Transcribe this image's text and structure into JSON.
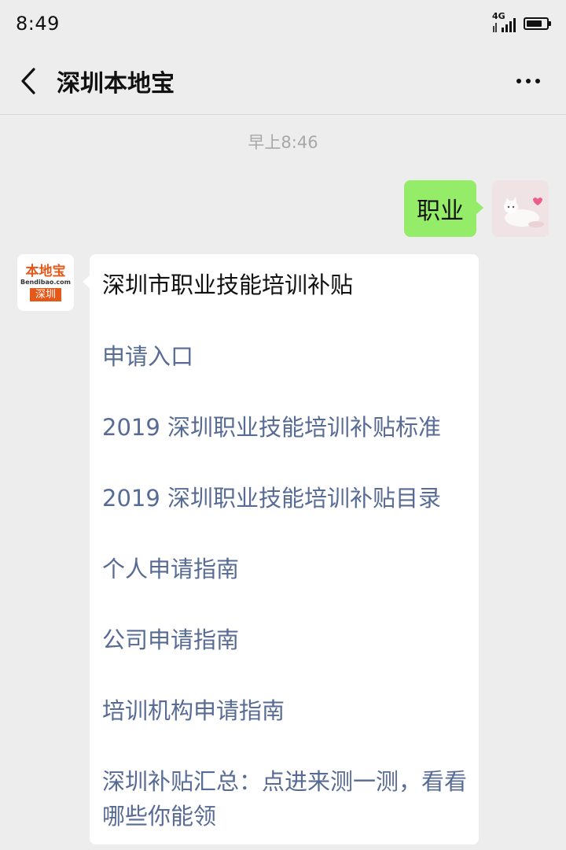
{
  "status_bar": {
    "time": "8:49",
    "network": "4G",
    "icons": [
      "signal-icon",
      "battery-icon"
    ],
    "battery_level": 0.8
  },
  "nav": {
    "title": "深圳本地宝",
    "icons": [
      "back-arrow-icon",
      "more-icon"
    ]
  },
  "chat": {
    "timestamp": "早上8:46",
    "messages": [
      {
        "sender": "me",
        "text": "职业"
      },
      {
        "sender": "bot",
        "avatar": {
          "logo_text": "本地宝",
          "logo_sub": "Bendibao.com",
          "logo_city": "深圳"
        },
        "title": "深圳市职业技能培训补贴",
        "links": [
          "申请入口",
          "2019 深圳职业技能培训补贴标准",
          "2019 深圳职业技能培训补贴目录",
          "个人申请指南",
          "公司申请指南",
          "培训机构申请指南",
          "深圳补贴汇总：点进来测一测，看看哪些你能领"
        ]
      }
    ]
  },
  "colors": {
    "background": "#ededed",
    "my_bubble": "#95ec69",
    "link": "#576b95",
    "brand": "#e4591a"
  }
}
